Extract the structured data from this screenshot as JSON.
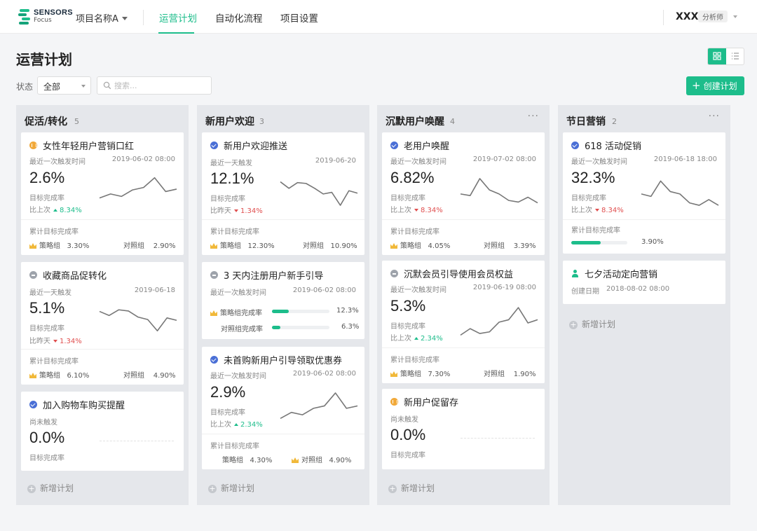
{
  "header": {
    "logo": {
      "brand": "SENSORS",
      "sub": "Focus"
    },
    "project": "项目名称A",
    "nav": [
      "运营计划",
      "自动化流程",
      "项目设置"
    ],
    "user": "XXX",
    "role": "分析师"
  },
  "page": {
    "title": "运营计划",
    "filter_label": "状态",
    "filter_value": "全部",
    "search_placeholder": "搜索...",
    "create_label": "创建计划",
    "add_label": "新增计划"
  },
  "labels": {
    "last_trigger": "最近一次触发时间",
    "last_day": "最近一天触发",
    "goal_rate": "目标完成率",
    "cum_rate": "累计目标完成率",
    "strategy": "策略组",
    "control": "对照组",
    "vs_last": "比上次",
    "vs_yesterday": "比昨天",
    "not_triggered": "尚未触发",
    "strategy_rate": "策略组完成率",
    "control_rate": "对照组完成率",
    "created": "创建日期"
  },
  "columns": [
    {
      "title": "促活/转化",
      "count": "5",
      "cards": [
        {
          "title": "女性年轻用户营销口红",
          "status_icon": "pause-icon",
          "date": "2019-06-02 08:00",
          "value": "2.6%",
          "delta": "8.34%",
          "delta_dir": "up",
          "strategy": "3.30%",
          "control": "2.90%",
          "trend": [
            3,
            4,
            3.4,
            5,
            5.6,
            8,
            4.6,
            5.2
          ]
        },
        {
          "title": "收藏商品促转化",
          "status_icon": "minus-icon",
          "date": "2019-06-18",
          "value": "5.1%",
          "delta": "1.34%",
          "delta_dir": "down",
          "strategy": "6.10%",
          "control": "4.90%",
          "trend": [
            7,
            6,
            7.4,
            7.1,
            5.6,
            5,
            2.2,
            5.4,
            4.8
          ]
        },
        {
          "title": "加入购物车购买提醒",
          "status_icon": "check-icon",
          "value": "0.0%"
        }
      ]
    },
    {
      "title": "新用户欢迎",
      "count": "3",
      "cards": [
        {
          "title": "新用户欢迎推送",
          "status_icon": "check-icon",
          "date": "2019-06-20",
          "value": "12.1%",
          "delta": "1.34%",
          "delta_dir": "down",
          "strategy": "12.30%",
          "control": "10.90%",
          "trend": [
            7,
            5.4,
            6.8,
            6.6,
            5.4,
            4,
            4.4,
            1.2,
            4.8,
            4.2
          ]
        },
        {
          "title": "3 天内注册用户新手引导",
          "status_icon": "minus-icon",
          "date": "2019-06-02 08:00",
          "strategy_rate": "12.3%",
          "strategy_rate_value": 0.123,
          "control_rate": "6.3%",
          "control_rate_value": 0.063
        },
        {
          "title": "未首购新用户引导领取优惠券",
          "status_icon": "check-icon",
          "date": "2019-06-02 08:00",
          "value": "2.9%",
          "delta": "2.34%",
          "delta_dir": "up",
          "strategy": "4.30%",
          "control": "4.90%",
          "trend": [
            1.5,
            3,
            2.4,
            4,
            4.6,
            7.8,
            4,
            4.6
          ]
        }
      ]
    },
    {
      "title": "沉默用户唤醒",
      "count": "4",
      "cards": [
        {
          "title": "老用户唤醒",
          "status_icon": "check-icon",
          "date": "2019-07-02 08:00",
          "value": "6.82%",
          "delta": "8.34%",
          "delta_dir": "down",
          "strategy": "4.05%",
          "control": "3.39%",
          "trend": [
            4,
            3.6,
            7.8,
            5,
            4,
            2.4,
            2,
            3.2,
            1.8
          ]
        },
        {
          "title": "沉默会员引导使用会员权益",
          "status_icon": "minus-icon",
          "date": "2019-06-19 08:00",
          "value": "5.3%",
          "delta": "2.34%",
          "delta_dir": "up",
          "strategy": "7.30%",
          "control": "1.90%",
          "trend": [
            0.8,
            2.4,
            1.2,
            1.6,
            4,
            4.6,
            7.6,
            3.8,
            4.6
          ]
        },
        {
          "title": "新用户促留存",
          "status_icon": "pause-icon",
          "value": "0.0%"
        }
      ]
    },
    {
      "title": "节日营销",
      "count": "2",
      "cards": [
        {
          "title": "618 活动促销",
          "status_icon": "check-icon",
          "date": "2019-06-18 18:00",
          "value": "32.3%",
          "delta": "8.34%",
          "delta_dir": "down",
          "cum_value": "3.90%",
          "cum_value_fraction": 0.22,
          "trend": [
            4,
            3.4,
            7.2,
            4.6,
            4,
            1.8,
            1.2,
            2.6,
            1.2
          ]
        },
        {
          "title": "七夕活动定向营销",
          "status_icon": "user-icon",
          "date": "2018-08-02 08:00"
        }
      ]
    }
  ],
  "colors": {
    "accent": "#1dbd8b",
    "down": "#e04f4f",
    "up": "#1dbd8b"
  }
}
